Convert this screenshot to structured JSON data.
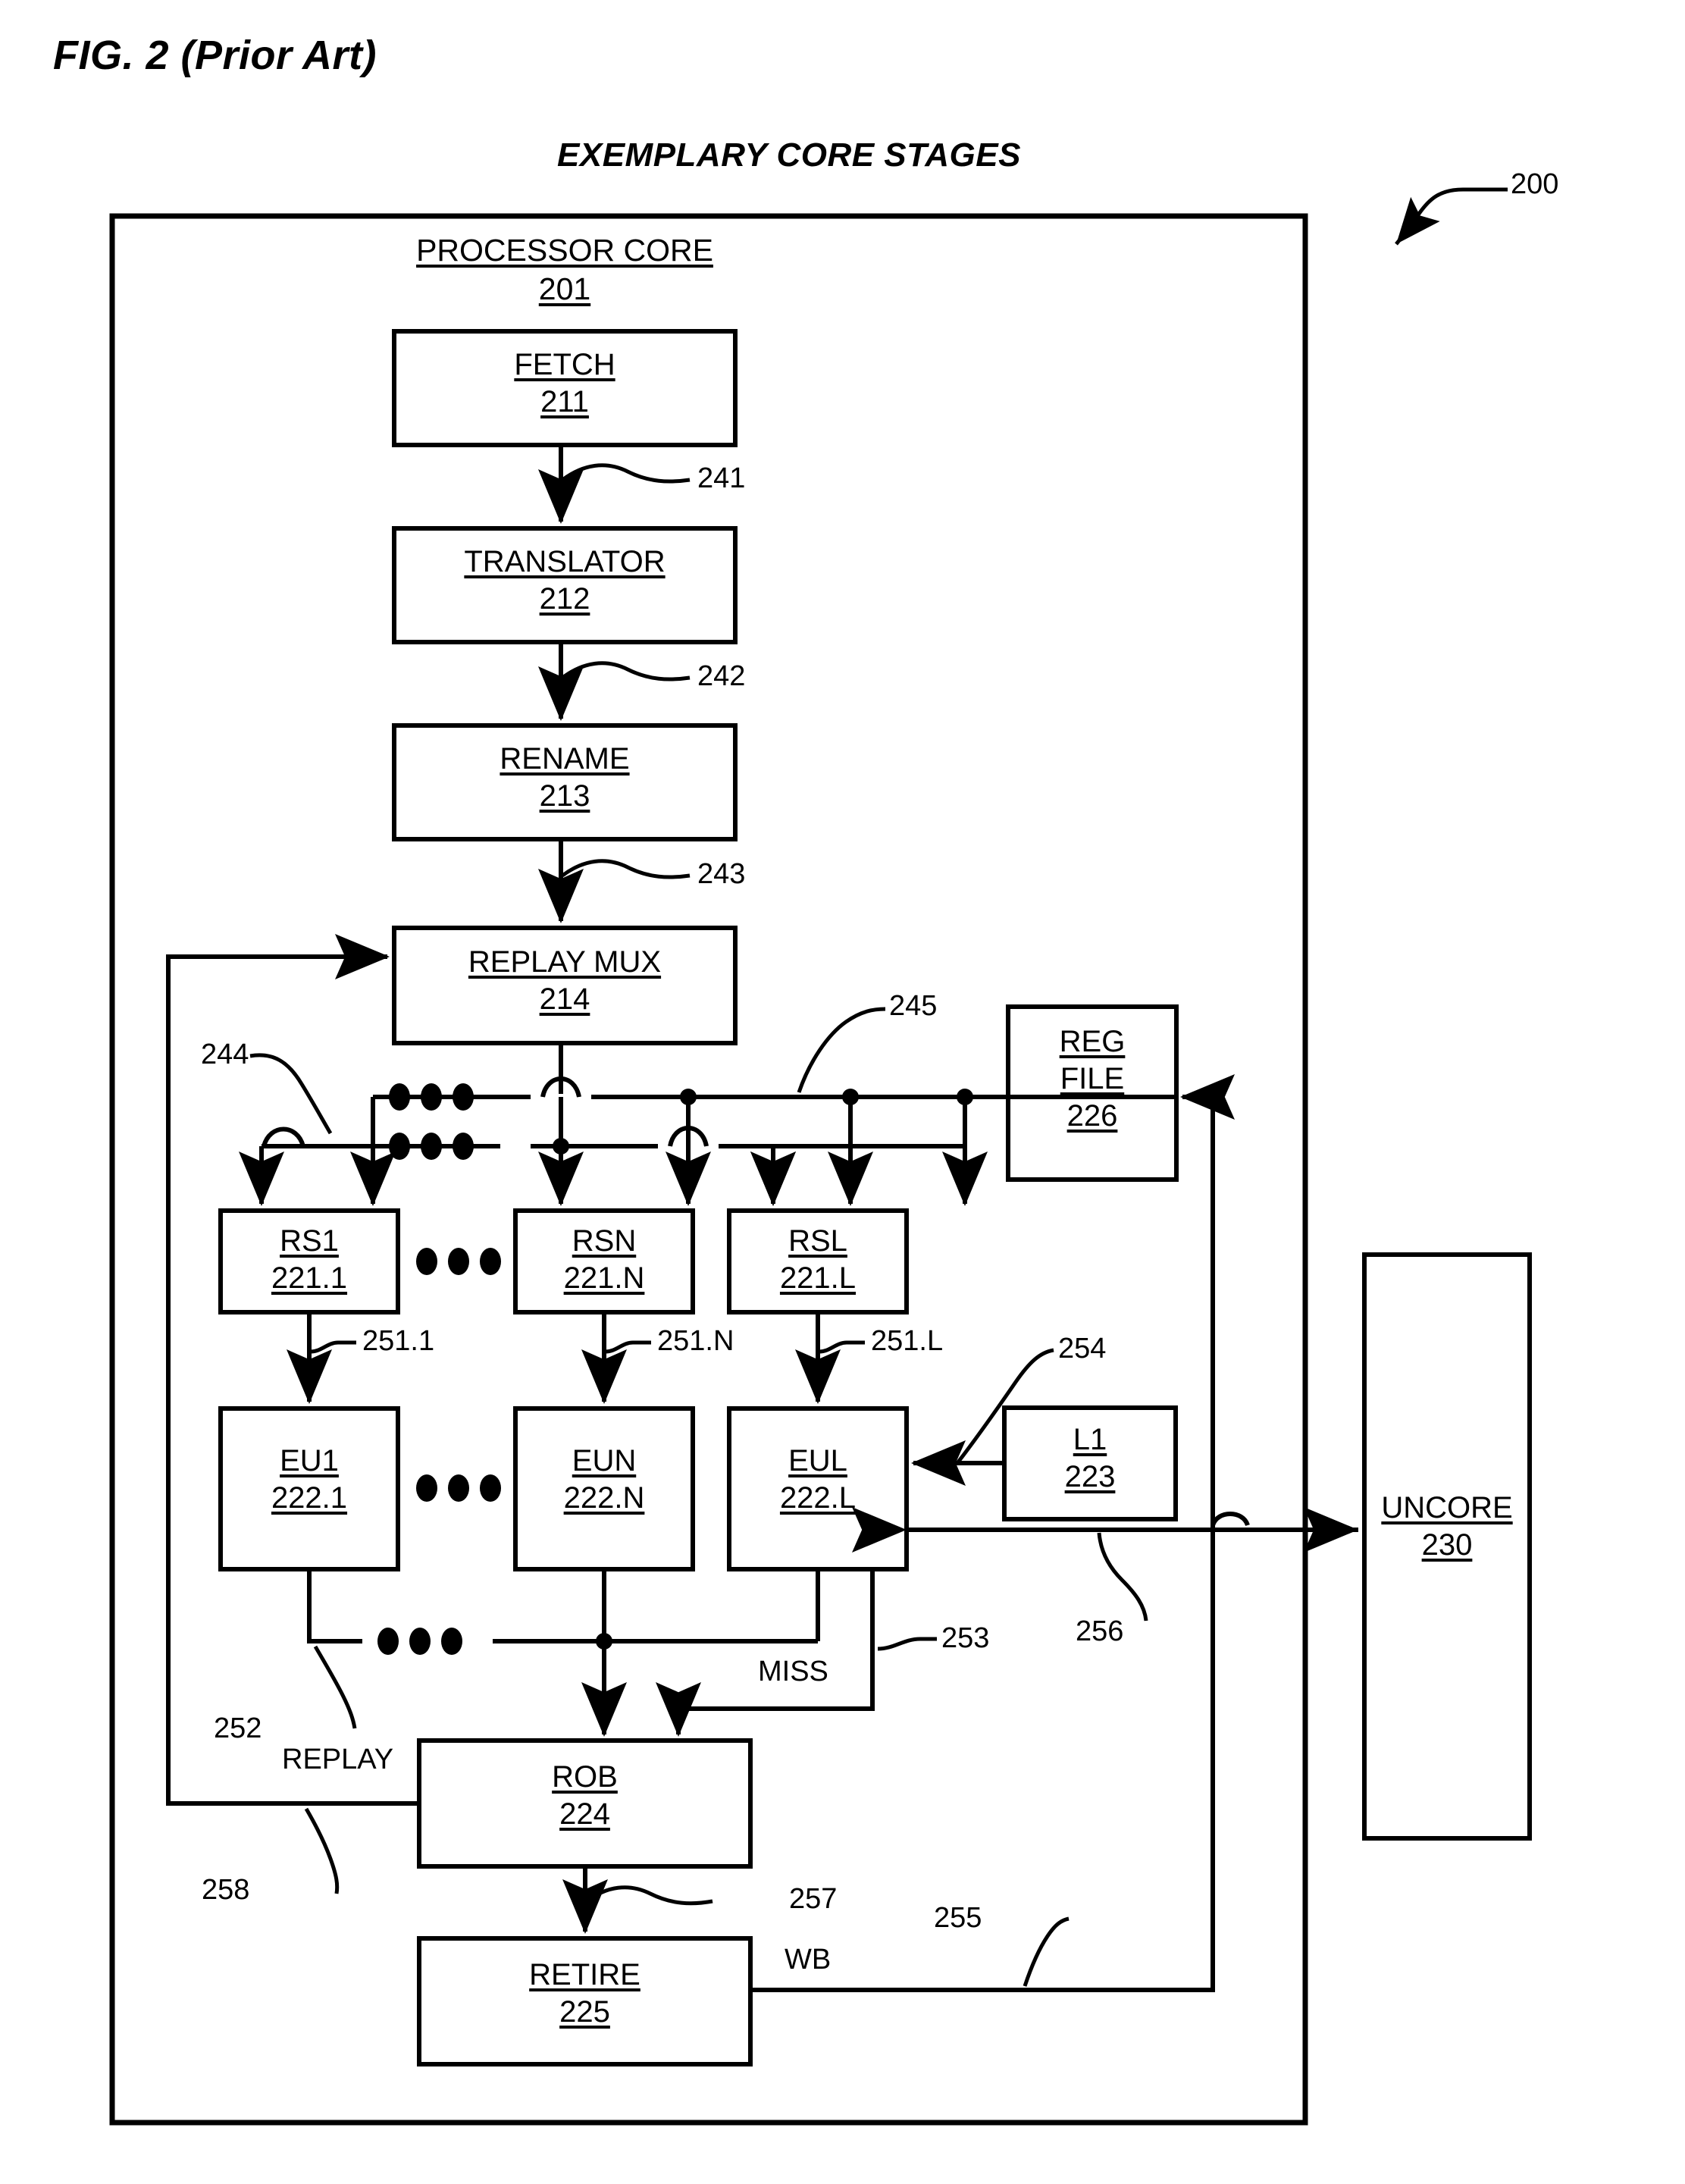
{
  "figure": {
    "title": "FIG. 2 (Prior Art)",
    "subtitle": "EXEMPLARY CORE STAGES",
    "overall_ref": "200"
  },
  "core": {
    "header_name": "PROCESSOR CORE",
    "header_ref": "201"
  },
  "blocks": {
    "fetch": {
      "name": "FETCH",
      "ref": "211"
    },
    "translator": {
      "name": "TRANSLATOR",
      "ref": "212"
    },
    "rename": {
      "name": "RENAME",
      "ref": "213"
    },
    "replay_mux": {
      "name": "REPLAY MUX",
      "ref": "214"
    },
    "rs1": {
      "name": "RS1",
      "ref": "221.1"
    },
    "rsn": {
      "name": "RSN",
      "ref": "221.N"
    },
    "rsl": {
      "name": "RSL",
      "ref": "221.L"
    },
    "eu1": {
      "name": "EU1",
      "ref": "222.1"
    },
    "eun": {
      "name": "EUN",
      "ref": "222.N"
    },
    "eul": {
      "name": "EUL",
      "ref": "222.L"
    },
    "l1": {
      "name": "L1",
      "ref": "223"
    },
    "rob": {
      "name": "ROB",
      "ref": "224"
    },
    "retire": {
      "name": "RETIRE",
      "ref": "225"
    },
    "reg_file": {
      "name_line1": "REG",
      "name_line2": "FILE",
      "ref": "226"
    },
    "uncore": {
      "name": "UNCORE",
      "ref": "230"
    }
  },
  "connectors": [
    {
      "id": "241",
      "label": "241"
    },
    {
      "id": "242",
      "label": "242"
    },
    {
      "id": "243",
      "label": "243"
    },
    {
      "id": "244",
      "label": "244"
    },
    {
      "id": "245",
      "label": "245"
    },
    {
      "id": "251_1",
      "label": "251.1"
    },
    {
      "id": "251_n",
      "label": "251.N"
    },
    {
      "id": "251_l",
      "label": "251.L"
    },
    {
      "id": "252",
      "label": "252"
    },
    {
      "id": "253",
      "label": "253"
    },
    {
      "id": "254",
      "label": "254"
    },
    {
      "id": "255",
      "label": "255"
    },
    {
      "id": "256",
      "label": "256"
    },
    {
      "id": "257",
      "label": "257"
    },
    {
      "id": "258",
      "label": "258"
    }
  ],
  "signal_labels": {
    "miss": "MISS",
    "replay": "REPLAY",
    "wb": "WB"
  },
  "colors": {
    "stroke": "#000000",
    "background": "#ffffff"
  }
}
